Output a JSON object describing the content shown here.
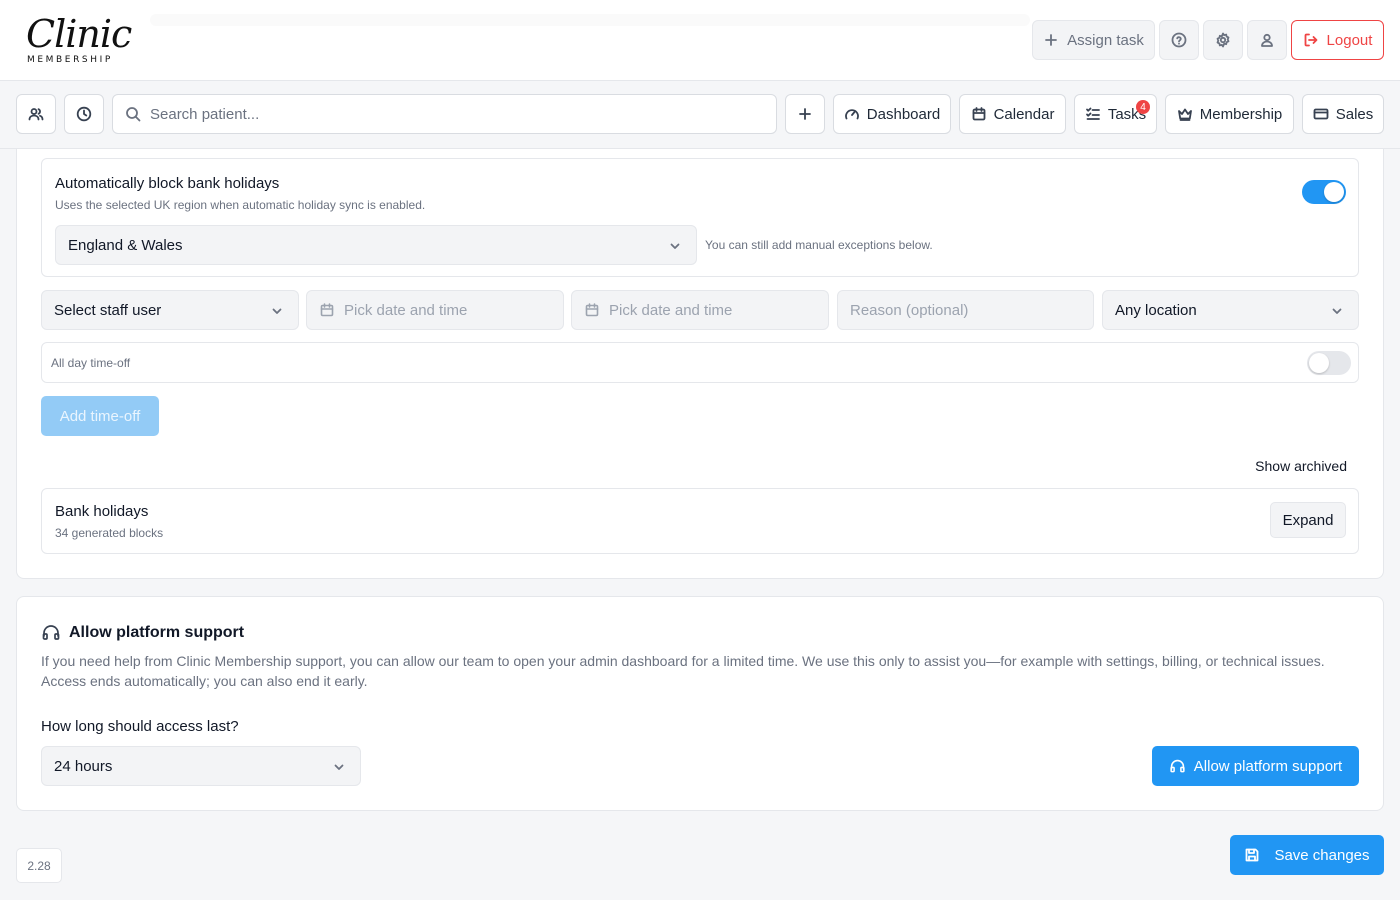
{
  "header": {
    "logo": {
      "script": "Clinic",
      "sub": "MEMBERSHIP"
    },
    "assign_task_label": "Assign task",
    "logout_label": "Logout",
    "colors": {
      "logout": "#ef4444"
    }
  },
  "navbar": {
    "search_placeholder": "Search patient...",
    "items": [
      {
        "label": "Dashboard",
        "icon": "gauge-icon"
      },
      {
        "label": "Calendar",
        "icon": "calendar-icon"
      },
      {
        "label": "Tasks",
        "icon": "checklist-icon",
        "badge": "4"
      },
      {
        "label": "Membership",
        "icon": "crown-icon"
      },
      {
        "label": "Sales",
        "icon": "credit-card-icon"
      }
    ]
  },
  "holidays": {
    "title": "Automatically block bank holidays",
    "description": "Uses the selected UK region when automatic holiday sync is enabled.",
    "enabled": true,
    "region": "England & Wales",
    "hint": "You can still add manual exceptions below."
  },
  "timeoff_form": {
    "staff_placeholder": "Select staff user",
    "start_placeholder": "Pick date and time",
    "end_placeholder": "Pick date and time",
    "reason_placeholder": "Reason (optional)",
    "location": "Any location",
    "all_day_label": "All day time-off",
    "all_day": false,
    "add_label": "Add time-off"
  },
  "archive": {
    "show_archived_label": "Show archived"
  },
  "bank_holidays": {
    "title": "Bank holidays",
    "subtitle": "34 generated blocks",
    "expand_label": "Expand"
  },
  "support": {
    "title": "Allow platform support",
    "description": "If you need help from Clinic Membership support, you can allow our team to open your admin dashboard for a limited time. We use this only to assist you—for example with settings, billing, or technical issues. Access ends automatically; you can also end it early.",
    "duration_label": "How long should access last?",
    "duration": "24 hours",
    "button_label": "Allow platform support"
  },
  "footer": {
    "version": "2.28",
    "save_label": "Save changes"
  },
  "colors": {
    "primary": "#2196f3",
    "primary_disabled": "#93cbf6",
    "toggle_off": "#e5e7eb"
  }
}
